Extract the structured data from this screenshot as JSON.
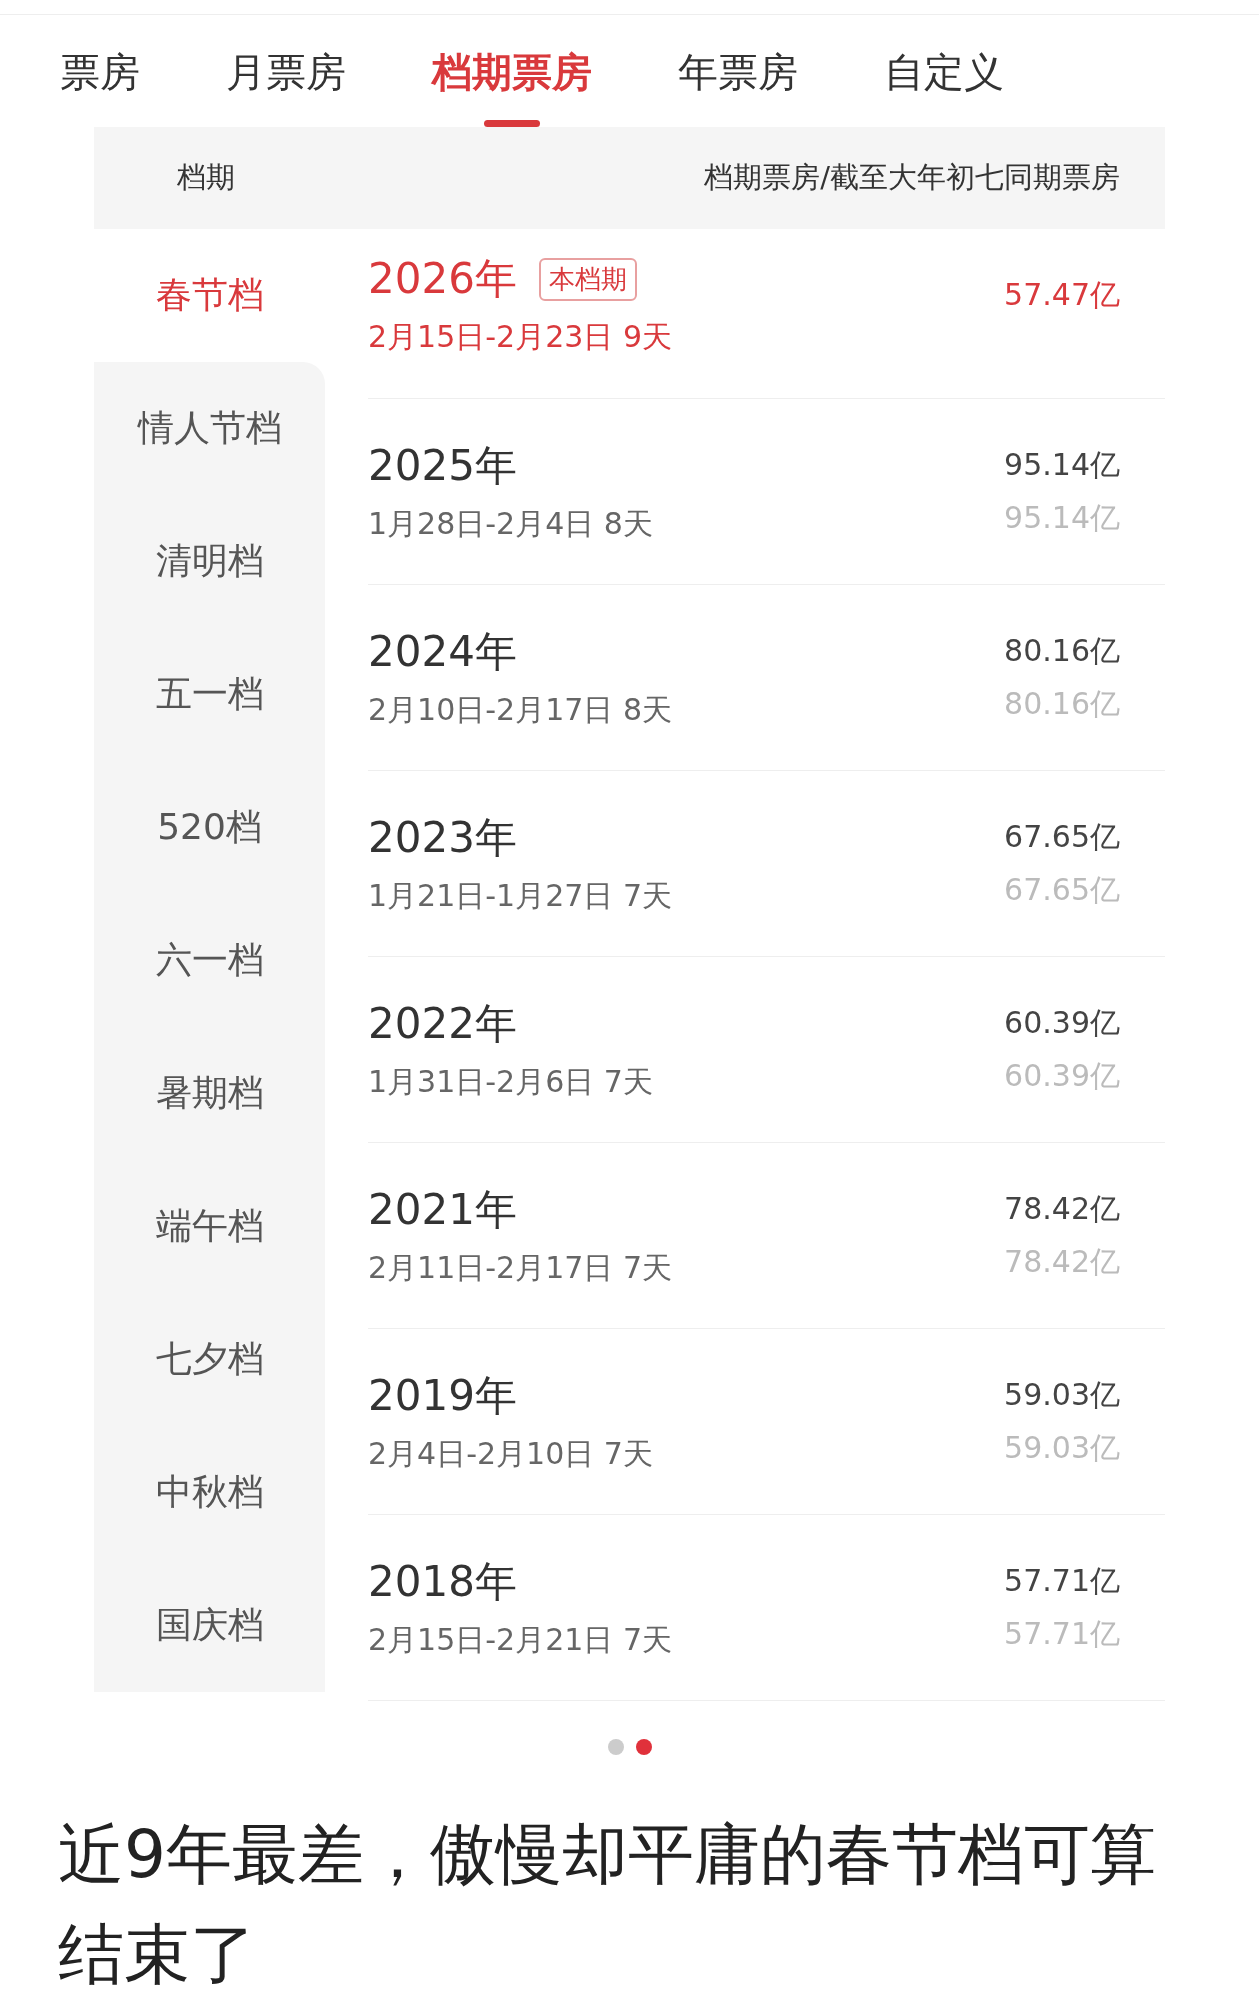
{
  "tabs": [
    {
      "label": "票房",
      "selected": false
    },
    {
      "label": "月票房",
      "selected": false
    },
    {
      "label": "档期票房",
      "selected": true
    },
    {
      "label": "年票房",
      "selected": false
    },
    {
      "label": "自定义",
      "selected": false
    }
  ],
  "table": {
    "columns": [
      "档期",
      "档期票房/截至大年初七同期票房"
    ],
    "sidebar": [
      {
        "label": "春节档",
        "selected": true
      },
      {
        "label": "情人节档",
        "selected": false
      },
      {
        "label": "清明档",
        "selected": false
      },
      {
        "label": "五一档",
        "selected": false
      },
      {
        "label": "520档",
        "selected": false
      },
      {
        "label": "六一档",
        "selected": false
      },
      {
        "label": "暑期档",
        "selected": false
      },
      {
        "label": "端午档",
        "selected": false
      },
      {
        "label": "七夕档",
        "selected": false
      },
      {
        "label": "中秋档",
        "selected": false
      },
      {
        "label": "国庆档",
        "selected": false
      }
    ],
    "rows": [
      {
        "year": "2026年",
        "badge": "本档期",
        "current": true,
        "dates": "2月15日-2月23日 9天",
        "values": [
          "57.47亿"
        ]
      },
      {
        "year": "2025年",
        "current": false,
        "dates": "1月28日-2月4日 8天",
        "values": [
          "95.14亿",
          "95.14亿"
        ]
      },
      {
        "year": "2024年",
        "current": false,
        "dates": "2月10日-2月17日 8天",
        "values": [
          "80.16亿",
          "80.16亿"
        ]
      },
      {
        "year": "2023年",
        "current": false,
        "dates": "1月21日-1月27日 7天",
        "values": [
          "67.65亿",
          "67.65亿"
        ]
      },
      {
        "year": "2022年",
        "current": false,
        "dates": "1月31日-2月6日 7天",
        "values": [
          "60.39亿",
          "60.39亿"
        ]
      },
      {
        "year": "2021年",
        "current": false,
        "dates": "2月11日-2月17日 7天",
        "values": [
          "78.42亿",
          "78.42亿"
        ]
      },
      {
        "year": "2019年",
        "current": false,
        "dates": "2月4日-2月10日 7天",
        "values": [
          "59.03亿",
          "59.03亿"
        ]
      },
      {
        "year": "2018年",
        "current": false,
        "dates": "2月15日-2月21日 7天",
        "values": [
          "57.71亿",
          "57.71亿"
        ]
      }
    ]
  },
  "pager": [
    {
      "selected": false
    },
    {
      "selected": true
    }
  ],
  "caption": "近9年最差，傲慢却平庸的春节档可算结束了"
}
